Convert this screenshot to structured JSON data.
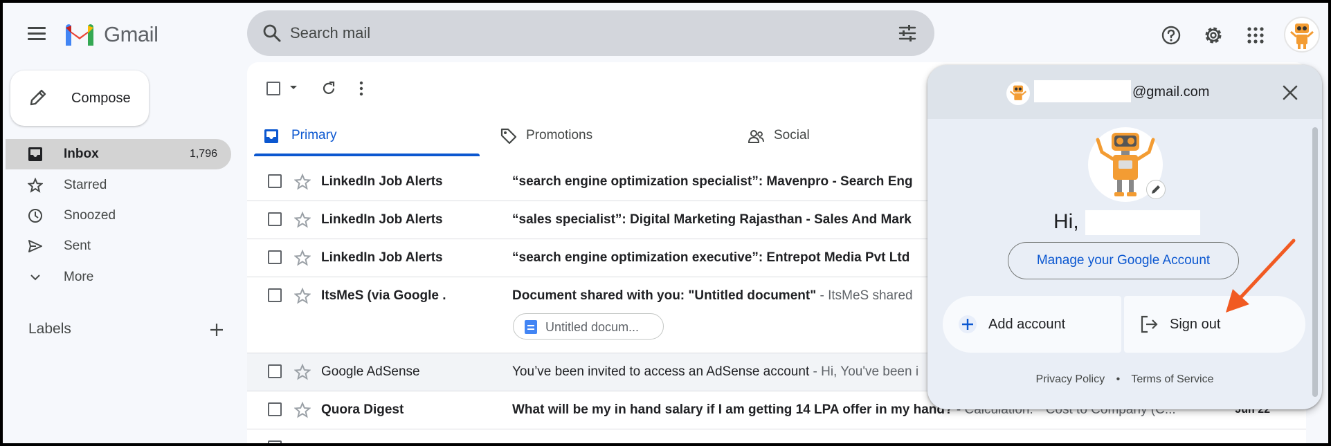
{
  "app": {
    "name": "Gmail"
  },
  "search": {
    "placeholder": "Search mail"
  },
  "compose": {
    "label": "Compose"
  },
  "nav": [
    {
      "label": "Inbox",
      "count": "1,796",
      "icon": "inbox-icon",
      "active": true
    },
    {
      "label": "Starred",
      "icon": "star-icon"
    },
    {
      "label": "Snoozed",
      "icon": "clock-icon"
    },
    {
      "label": "Sent",
      "icon": "send-icon"
    },
    {
      "label": "More",
      "icon": "chevron-down-icon"
    }
  ],
  "labels": {
    "title": "Labels"
  },
  "tabs": [
    {
      "label": "Primary",
      "active": true
    },
    {
      "label": "Promotions"
    },
    {
      "label": "Social"
    }
  ],
  "emails": [
    {
      "sender": "LinkedIn Job Alerts",
      "subject": "“search engine optimization specialist”: Mavenpro - Search Eng",
      "snippet": "",
      "date": "",
      "read": false
    },
    {
      "sender": "LinkedIn Job Alerts",
      "subject": "“sales specialist”: Digital Marketing Rajasthan - Sales And Mark",
      "snippet": "",
      "date": "",
      "read": false
    },
    {
      "sender": "LinkedIn Job Alerts",
      "subject": "“search engine optimization executive”: Entrepot Media Pvt Ltd",
      "snippet": "",
      "date": "",
      "read": false
    },
    {
      "sender": "ItsMeS (via Google .",
      "subject": "Document shared with you: \"Untitled document\"",
      "snippet": " - ItsMeS shared",
      "date": "",
      "read": false,
      "attachment": "Untitled docum..."
    },
    {
      "sender": "Google AdSense",
      "subject": "You’ve been invited to access an AdSense account",
      "snippet": " - Hi, You've been i",
      "date": "",
      "read": true
    },
    {
      "sender": "Quora Digest",
      "subject": "What will be my in hand salary if I am getting 14 LPA offer in my hand?",
      "snippet": " - Calculation: * Cost to Company (C...",
      "date": "Jun 22",
      "read": false
    }
  ],
  "account_popup": {
    "email_suffix": "@gmail.com",
    "greeting": "Hi,",
    "manage_label": "Manage your Google Account",
    "add_account_label": "Add account",
    "sign_out_label": "Sign out",
    "privacy_label": "Privacy Policy",
    "footer_separator": "•",
    "terms_label": "Terms of Service"
  },
  "colors": {
    "accent_blue": "#0b57d0",
    "annotation_arrow": "#f15a22",
    "avatar_orange": "#f39c33"
  }
}
